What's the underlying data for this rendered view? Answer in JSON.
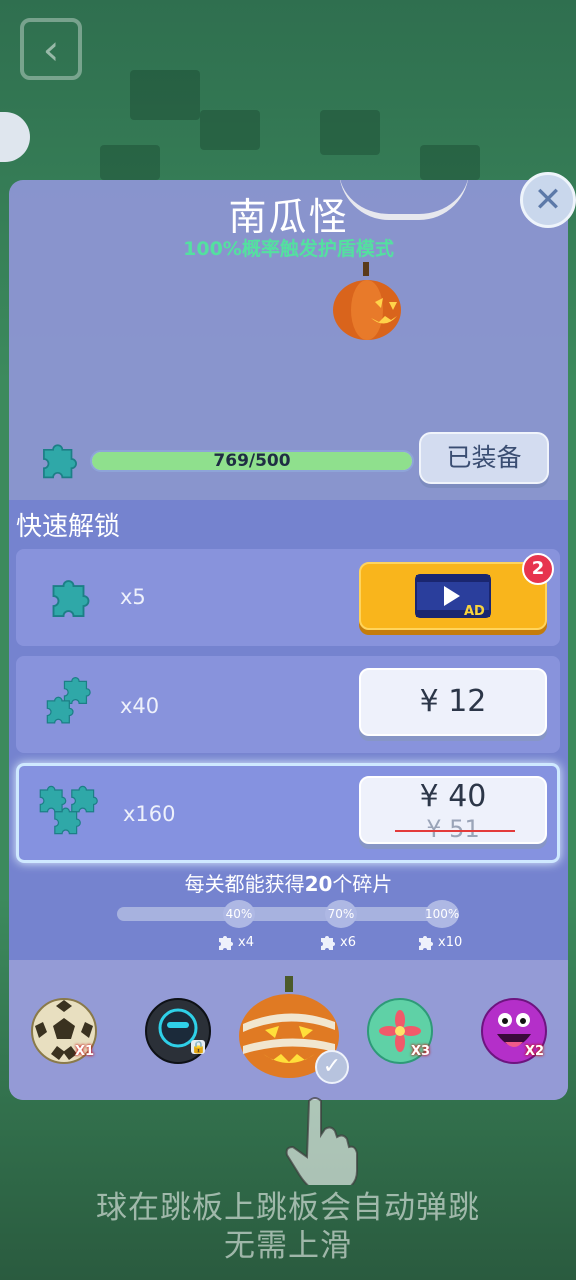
{
  "background": {
    "back_icon": "back-arrow-icon"
  },
  "panel": {
    "title": "南瓜怪",
    "subtitle": "100%概率触发护盾模式",
    "close_icon": "close-icon",
    "progress": {
      "current": 769,
      "target": 500,
      "text": "769/500"
    },
    "equip_label": "已装备"
  },
  "quick_unlock": {
    "title": "快速解锁",
    "offers": [
      {
        "qty_label": "x5",
        "action": "ad",
        "ad_icon": "video-ad-icon",
        "ad_text": "AD",
        "badge": "2"
      },
      {
        "qty_label": "x40",
        "price": "¥ 12"
      },
      {
        "qty_label": "x160",
        "price": "¥ 40",
        "old_price": "¥ 51"
      }
    ]
  },
  "milestones": {
    "info_prefix": "每关都能获得",
    "info_count": "20",
    "info_suffix": "个碎片",
    "points": [
      {
        "percent": "40%",
        "reward": "x4"
      },
      {
        "percent": "70%",
        "reward": "x6"
      },
      {
        "percent": "100%",
        "reward": "x10"
      }
    ]
  },
  "carousel": [
    {
      "name": "soccer-ball",
      "mult": "X1"
    },
    {
      "name": "robot-ball-locked",
      "mult": ""
    },
    {
      "name": "mummy-pumpkin-selected",
      "mult": ""
    },
    {
      "name": "flower-ball",
      "mult": "X3"
    },
    {
      "name": "purple-monster-ball",
      "mult": "X2"
    }
  ],
  "hint": {
    "line1": "球在跳板上跳板会自动弹跳",
    "line2": "无需上滑"
  },
  "colors": {
    "accent_green": "#54e0a0",
    "ad_orange": "#f9b51c",
    "badge_red": "#e7344e"
  }
}
